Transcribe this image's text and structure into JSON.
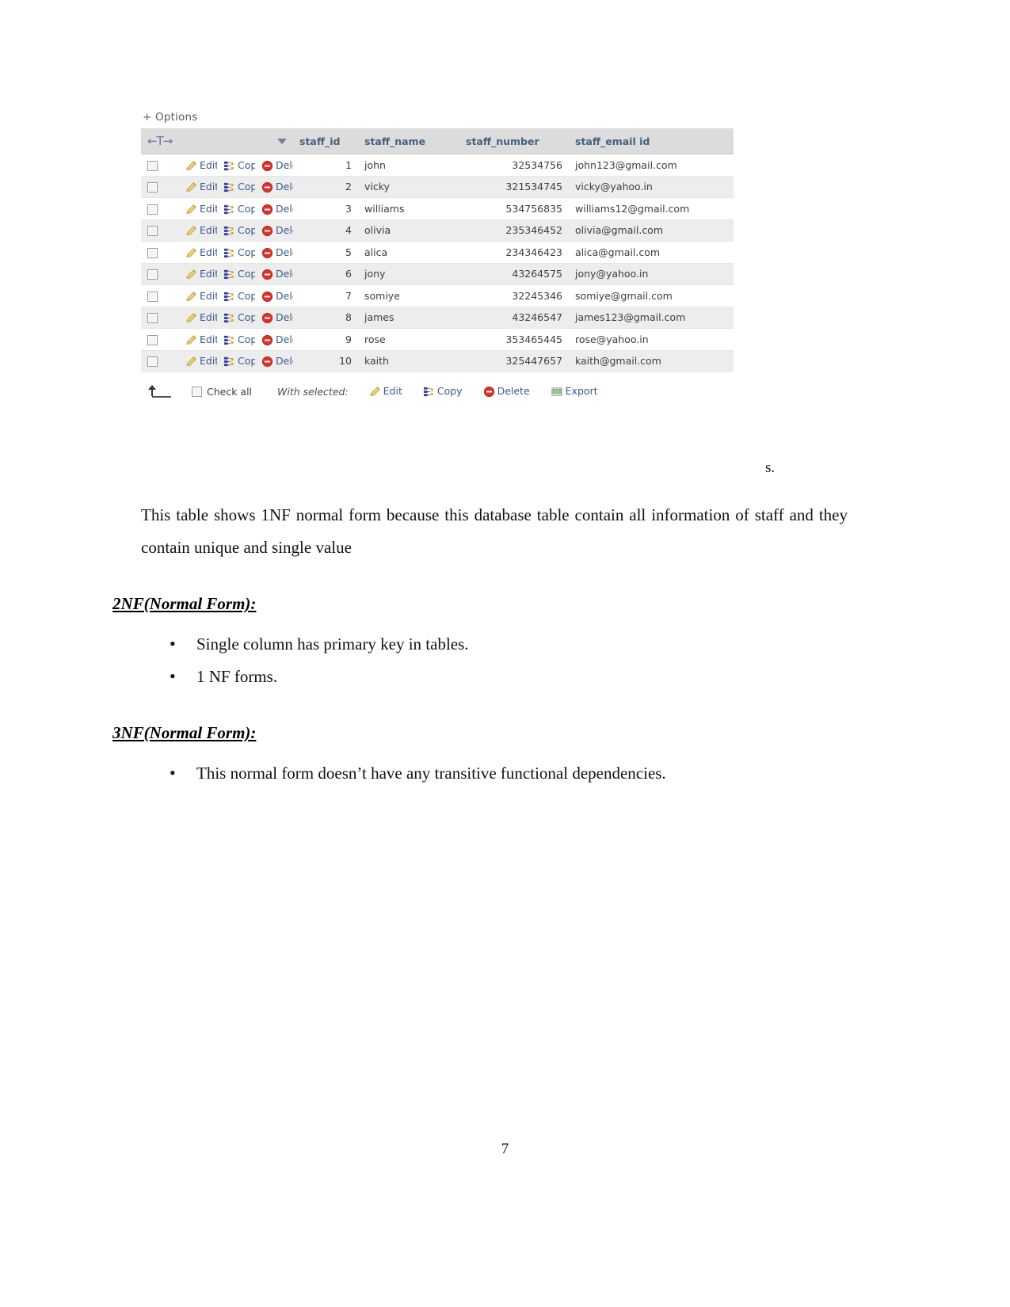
{
  "pma": {
    "options_label": "+ Options",
    "sort_header": {
      "arrow_glyph": "←T→",
      "caret": "sort-caret"
    },
    "columns": [
      "staff_id",
      "staff_name",
      "staff_number",
      "staff_email id"
    ],
    "row_actions": {
      "edit": "Edit",
      "copy": "Copy",
      "delete": "Delete"
    },
    "rows": [
      {
        "staff_id": "1",
        "staff_name": "john",
        "staff_number": "32534756",
        "staff_email": "john123@gmail.com"
      },
      {
        "staff_id": "2",
        "staff_name": "vicky",
        "staff_number": "321534745",
        "staff_email": "vicky@yahoo.in"
      },
      {
        "staff_id": "3",
        "staff_name": "williams",
        "staff_number": "534756835",
        "staff_email": "williams12@gmail.com"
      },
      {
        "staff_id": "4",
        "staff_name": "olivia",
        "staff_number": "235346452",
        "staff_email": "olivia@gmail.com"
      },
      {
        "staff_id": "5",
        "staff_name": "alica",
        "staff_number": "234346423",
        "staff_email": "alica@gmail.com"
      },
      {
        "staff_id": "6",
        "staff_name": "jony",
        "staff_number": "43264575",
        "staff_email": "jony@yahoo.in"
      },
      {
        "staff_id": "7",
        "staff_name": "somiye",
        "staff_number": "32245346",
        "staff_email": "somiye@gmail.com"
      },
      {
        "staff_id": "8",
        "staff_name": "james",
        "staff_number": "43246547",
        "staff_email": "james123@gmail.com"
      },
      {
        "staff_id": "9",
        "staff_name": "rose",
        "staff_number": "353465445",
        "staff_email": "rose@yahoo.in"
      },
      {
        "staff_id": "10",
        "staff_name": "kaith",
        "staff_number": "325447657",
        "staff_email": "kaith@gmail.com"
      }
    ],
    "footer": {
      "check_all": "Check all",
      "with_selected": "With selected:",
      "edit": "Edit",
      "copy": "Copy",
      "delete": "Delete",
      "export": "Export"
    },
    "colors": {
      "header_bg": "#dcdcdc",
      "header_text": "#44617f",
      "link": "#3a5a8c",
      "row_alt_bg": "#ededed",
      "delete_icon": "#d9342b",
      "edit_icon": "#f2c14a"
    }
  },
  "stray_text": "s.",
  "doc": {
    "paragraph_1": "This table shows 1NF normal form because this database table contain all information of staff and they contain unique and single value",
    "heading_2nf": "2NF(Normal Form):",
    "bullets_2nf": [
      "Single column has primary key in tables.",
      "1 NF forms."
    ],
    "heading_3nf": "3NF(Normal Form):",
    "bullets_3nf": [
      "This normal form doesn’t have any transitive functional dependencies."
    ]
  },
  "page_number": "7"
}
